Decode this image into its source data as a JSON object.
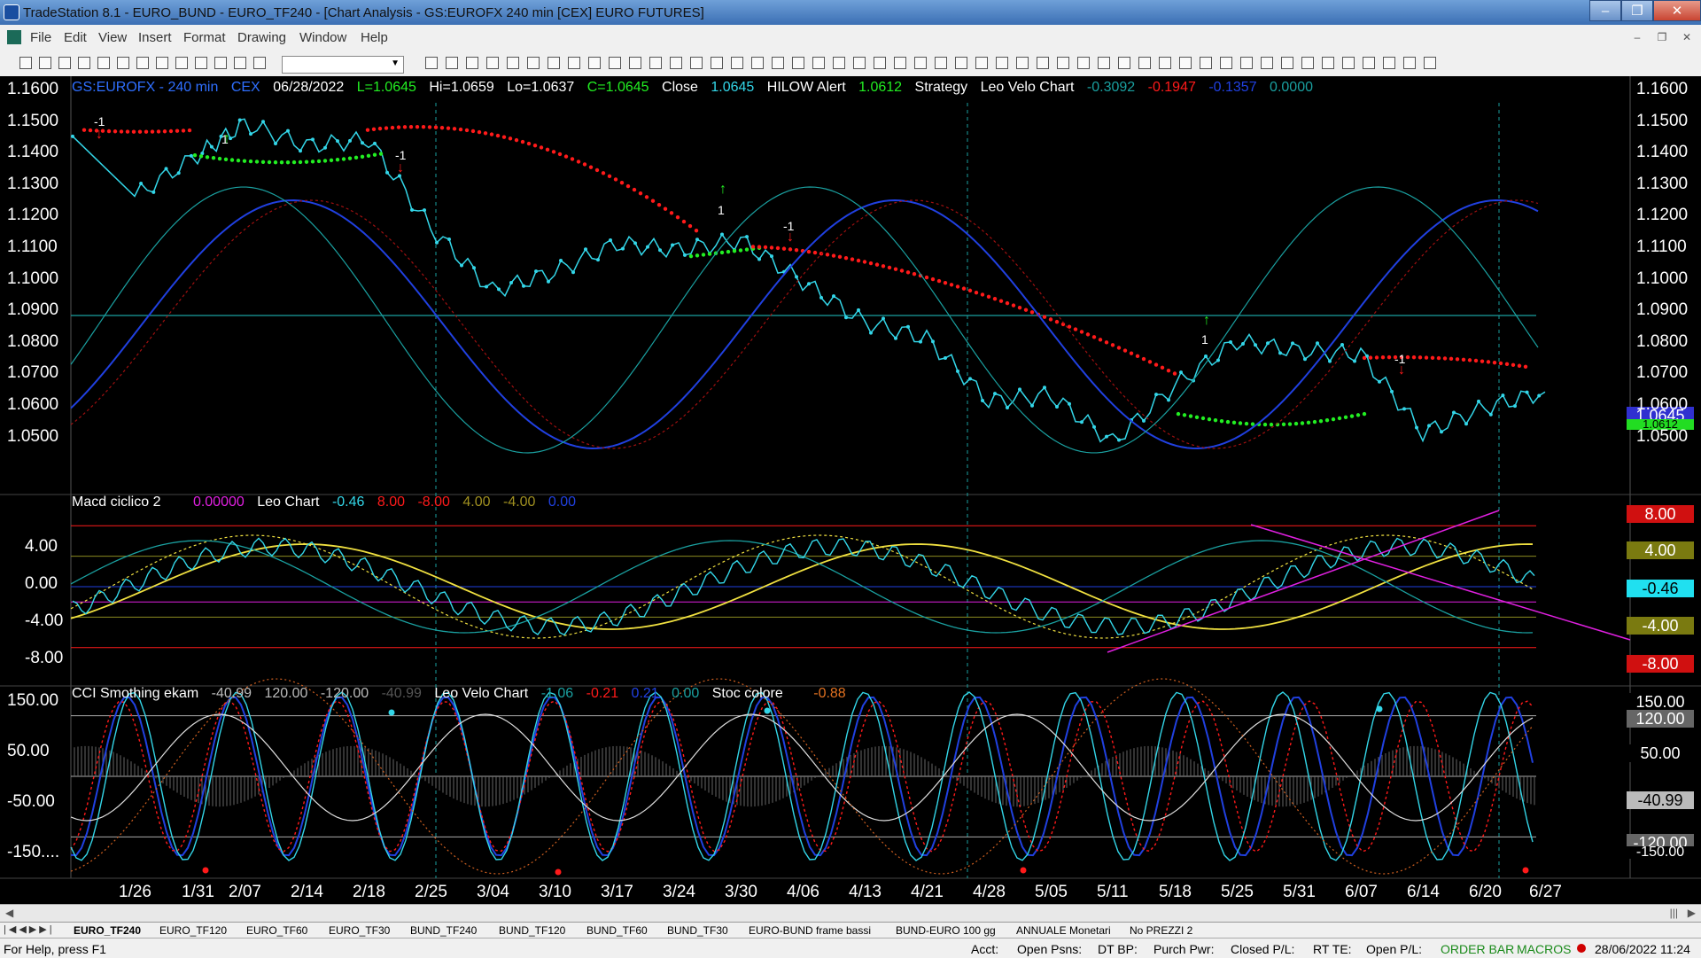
{
  "window": {
    "title": "TradeStation 8.1 - EURO_BUND - EURO_TF240 - [Chart Analysis - GS:EUROFX  240 min  [CEX] EURO FUTURES]"
  },
  "menu": [
    "File",
    "Edit",
    "View",
    "Insert",
    "Format",
    "Drawing",
    "Window",
    "Help"
  ],
  "price_pane": {
    "symbol": "GS:EUROFX - 240 min",
    "exchange": "CEX",
    "date": "06/28/2022",
    "low_val": "L=1.0645",
    "hi": "Hi=1.0659",
    "lo": "Lo=1.0637",
    "close_val": "C=1.0645",
    "close_label": "Close",
    "close_num": "1.0645",
    "hilow_label": "HILOW Alert",
    "hilow_num": "1.0612",
    "strategy_label": "Strategy",
    "leo_label": "Leo Velo Chart",
    "leo_v1": "-0.3092",
    "leo_v2": "-0.1947",
    "leo_v3": "-0.1357",
    "leo_v4": "0.0000",
    "ticks": [
      "1.1600",
      "1.1500",
      "1.1400",
      "1.1300",
      "1.1200",
      "1.1100",
      "1.1000",
      "1.0900",
      "1.0800",
      "1.0700",
      "1.0600",
      "1.0500"
    ],
    "tag_close": "1.0645",
    "tag_hilow": "1.0612",
    "markers": [
      "-1",
      "1",
      "-1",
      "1",
      "-1",
      "1",
      "-1"
    ]
  },
  "macd_pane": {
    "title": "Macd ciclico 2",
    "v0": "0.00000",
    "leo_label": "Leo Chart",
    "v1": "-0.46",
    "v2": "8.00",
    "v3": "-8.00",
    "v4": "4.00",
    "v5": "-4.00",
    "v6": "0.00",
    "ticks": [
      "4.00",
      "0.00",
      "-4.00",
      "-8.00"
    ],
    "tags": [
      "8.00",
      "4.00",
      "-0.46",
      "-4.00",
      "-8.00"
    ]
  },
  "cci_pane": {
    "title": "CCI Smothing ekam",
    "v1": "-40.99",
    "v2": "120.00",
    "v3": "-120.00",
    "v4": "-40.99",
    "leo_label": "Leo Velo Chart",
    "l1": "-1.06",
    "l2": "-0.21",
    "l3": "0.21",
    "l4": "0.00",
    "stoc_label": "Stoc colore",
    "stoc_val": "-0.88",
    "ticks": [
      "150.00",
      "50.00",
      "-50.00",
      "-150...."
    ],
    "tags": [
      "150.00",
      "120.00",
      "50.00",
      "-40.99",
      "-120.00",
      "-150.00"
    ]
  },
  "chart_data": {
    "type": "line",
    "title": "GS:EUROFX - 240 min",
    "x": [
      "1/26",
      "1/31",
      "2/07",
      "2/14",
      "2/18",
      "2/25",
      "3/04",
      "3/10",
      "3/17",
      "3/24",
      "3/30",
      "4/06",
      "4/13",
      "4/21",
      "4/28",
      "5/05",
      "5/11",
      "5/18",
      "5/25",
      "5/31",
      "6/07",
      "6/14",
      "6/20",
      "6/27"
    ],
    "series": [
      {
        "name": "Close",
        "values": [
          1.127,
          1.14,
          1.15,
          1.143,
          1.145,
          1.117,
          1.097,
          1.103,
          1.112,
          1.11,
          1.113,
          1.1,
          1.087,
          1.082,
          1.062,
          1.064,
          1.049,
          1.067,
          1.081,
          1.078,
          1.077,
          1.052,
          1.06,
          1.065
        ]
      }
    ],
    "ylim": [
      1.045,
      1.165
    ]
  },
  "tabs": [
    "EURO_TF240",
    "EURO_TF120",
    "EURO_TF60",
    "EURO_TF30",
    "BUND_TF240",
    "BUND_TF120",
    "BUND_TF60",
    "BUND_TF30",
    "EURO-BUND frame bassi",
    "BUND-EURO 100 gg",
    "ANNUALE Monetari",
    "No PREZZI 2"
  ],
  "status": {
    "help": "For Help, press F1",
    "acct": "Acct:",
    "open_psns": "Open Psns:",
    "dtbp": "DT BP:",
    "purch": "Purch Pwr:",
    "closed_pl": "Closed P/L:",
    "rtte": "RT TE:",
    "open_pl": "Open P/L:",
    "order": "ORDER BAR",
    "macros": "MACROS",
    "datetime": "28/06/2022 11:24"
  },
  "colors": {
    "price": "#33d6e8",
    "red": "#ff1a1a",
    "green": "#22ee22",
    "yellow": "#f0e040",
    "magenta": "#e020e0",
    "blue": "#2040e0",
    "teal": "#1aa0a0"
  }
}
